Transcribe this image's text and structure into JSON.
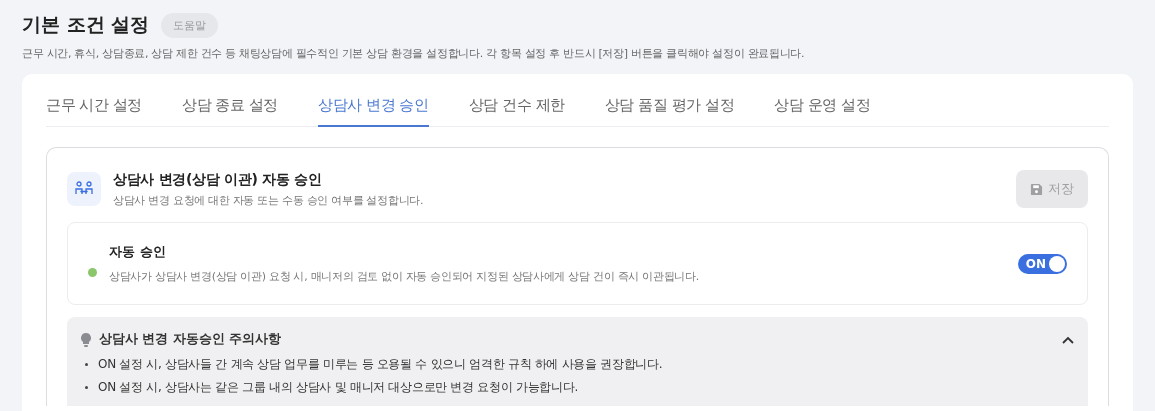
{
  "header": {
    "title": "기본 조건 설정",
    "help_button": "도움말",
    "description": "근무 시간, 휴식, 상담종료, 상담 제한 건수 등 채팅상담에 필수적인 기본 상담 환경을 설정합니다. 각 항목 설정 후 반드시 [저장] 버튼을 클릭해야 설정이 완료됩니다."
  },
  "tabs": [
    {
      "label": "근무 시간 설정",
      "selected": false
    },
    {
      "label": "상담 종료 설정",
      "selected": false
    },
    {
      "label": "상담사 변경 승인",
      "selected": true
    },
    {
      "label": "상담 건수 제한",
      "selected": false
    },
    {
      "label": "상담 품질 평가 설정",
      "selected": false
    },
    {
      "label": "상담 운영 설정",
      "selected": false
    }
  ],
  "section": {
    "title": "상담사 변경(상담 이관) 자동 승인",
    "subtitle": "상담사 변경 요청에 대한 자동 또는 수동 승인 여부를 설정합니다.",
    "save_button": {
      "label": "저장",
      "disabled": true
    }
  },
  "option": {
    "title": "자동 승인",
    "description": "상담사가 상담사 변경(상담 이관) 요청 시, 매니저의 검토 없이 자동 승인되어 지정된 상담사에게 상담 건이 즉시 이관됩니다.",
    "color": "#8bc66a",
    "toggle": {
      "on": true,
      "label": "ON"
    }
  },
  "notice": {
    "title": "상담사 변경 자동승인 주의사항",
    "expanded": true,
    "items": [
      "ON 설정 시, 상담사들 간 계속 상담 업무를 미루는 등 오용될 수 있으니 엄격한 규칙 하에 사용을 권장합니다.",
      "ON 설정 시, 상담사는 같은 그룹 내의 상담사 및 매니저 대상으로만 변경 요청이 가능합니다."
    ]
  }
}
